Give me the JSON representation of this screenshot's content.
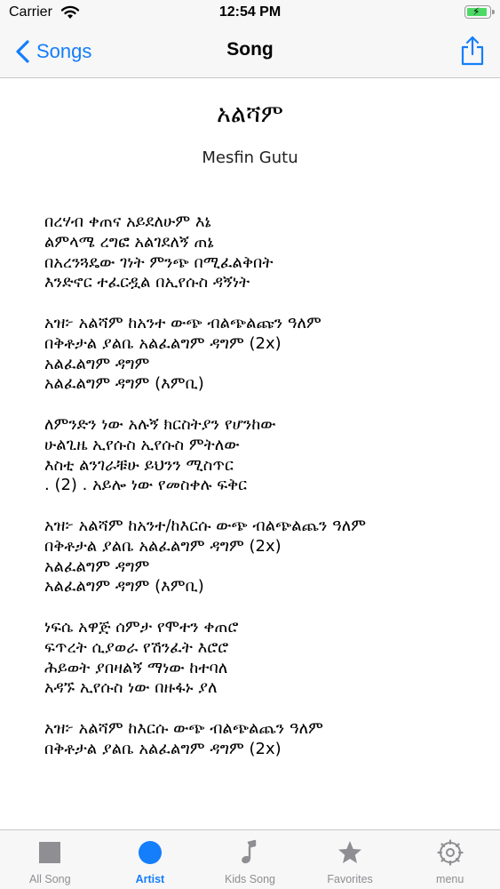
{
  "status_bar": {
    "carrier": "Carrier",
    "time": "12:54 PM"
  },
  "nav": {
    "back_label": "Songs",
    "title": "Song"
  },
  "song": {
    "title": "አልሻም",
    "artist": "Mesfin Gutu",
    "stanzas": [
      [
        "በረሃብ ቀጠና አይደለሁም እኔ",
        "ልምላሜ ረግፎ አልገደለኝ ጠኔ",
        "በአረንጓዴው ገነት ምንጭ በሚፈልቅበት",
        "እንድኖር ተፈርዷል በኢየሱስ ዳኝነት"
      ],
      [
        "አዝ፦ አልሻም ከአንተ ውጭ ብልጭልጩን ዓለም",
        "በቅቶታል ያልቤ አልፈልግም ዳግም (2x)",
        "አልፈልግም ዳግም",
        "አልፈልግም ዳግም (እምቢ)"
      ],
      [
        "ለምንድን ነው አሉኝ ክርስትያን የሆንከው",
        "ሁልጊዜ ኢየሱስ ኢየሱስ ምትለው",
        "እስቲ ልንገራቹሁ ይህንን ሚስጥር",
        ". (2) . አይሎ ነው የመስቀሉ ፍቅር"
      ],
      [
        "አዝ፦ አልሻም ከአንተ/ከእርሱ ውጭ ብልጭልጨን ዓለም",
        "በቅቶታል ያልቤ አልፈልግም ዳግም (2x)",
        "አልፈልግም ዳግም",
        "አልፈልግም ዳግም (እምቢ)"
      ],
      [
        "ነፍሴ አዋጅ ሰምታ የሞተን ቀጠሮ",
        "ፍጥረት ሲያወራ የሽንፈት እሮሮ",
        "ሕይወት ያበዛልኝ ማነው ከተባለ",
        "አዳኙ ኢየሱስ ነው በዙፋኑ ያለ"
      ],
      [
        "አዝ፦ አልሻም ከእርሱ ውጭ ብልጭልጨን ዓለም",
        "በቅቶታል ያልቤ አልፈልግም ዳግም (2x)"
      ]
    ]
  },
  "tabs": [
    {
      "label": "All Song",
      "icon": "square-icon",
      "active": false
    },
    {
      "label": "Artist",
      "icon": "circle-icon",
      "active": true
    },
    {
      "label": "Kids Song",
      "icon": "music-note-icon",
      "active": false
    },
    {
      "label": "Favorites",
      "icon": "star-icon",
      "active": false
    },
    {
      "label": "menu",
      "icon": "gear-icon",
      "active": false
    }
  ],
  "colors": {
    "accent": "#147efb",
    "inactive": "#8e8e93",
    "bar_background": "#f7f7f7"
  }
}
